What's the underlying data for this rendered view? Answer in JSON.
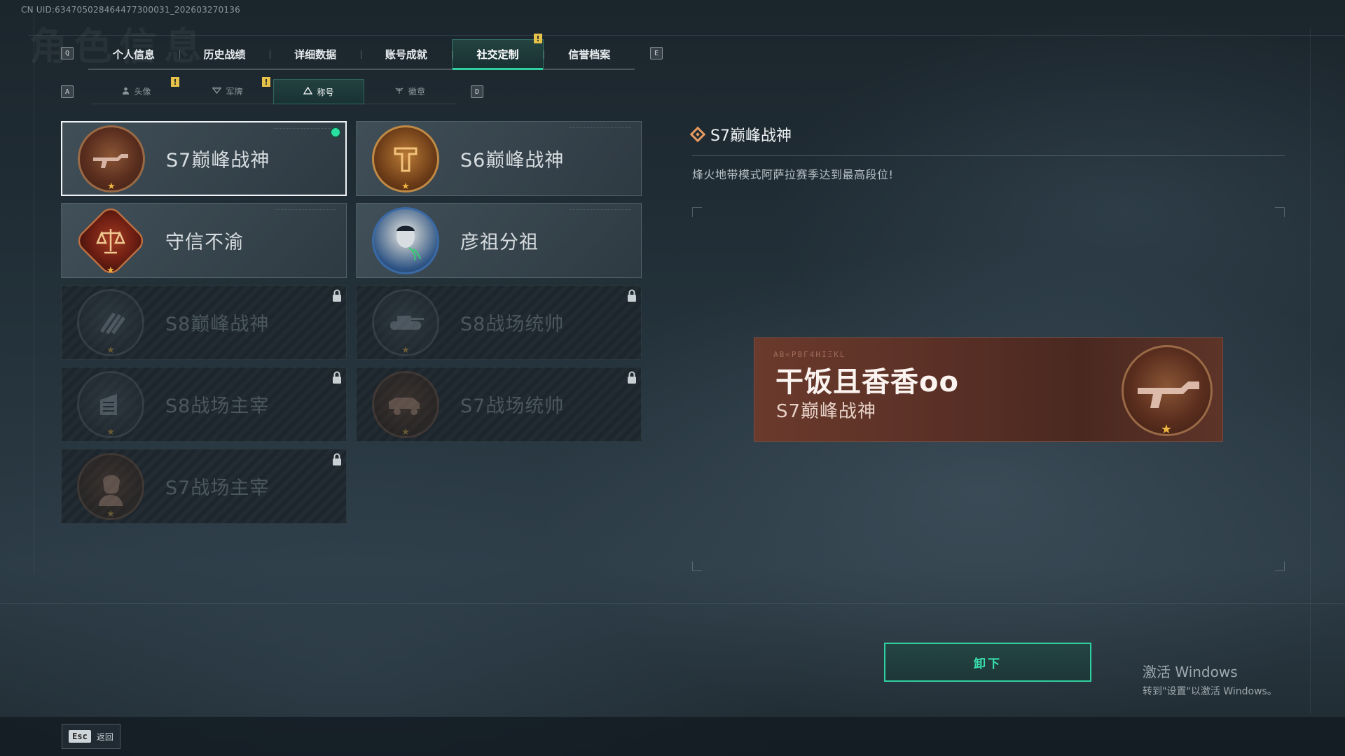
{
  "header": {
    "uid": "CN UID:634705028464477300031_202603270136",
    "bg_title": "角色信息"
  },
  "main_tabs": {
    "prev_key": "Q",
    "next_key": "E",
    "items": [
      {
        "label": "个人信息"
      },
      {
        "label": "历史战绩"
      },
      {
        "label": "详细数据"
      },
      {
        "label": "账号成就"
      },
      {
        "label": "社交定制",
        "active": true,
        "badge": "!"
      },
      {
        "label": "信誉档案"
      }
    ]
  },
  "sub_tabs": {
    "prev_key": "A",
    "next_key": "D",
    "items": [
      {
        "label": "头像",
        "icon": "person-icon",
        "badge": "!"
      },
      {
        "label": "军牌",
        "icon": "dogtag-icon",
        "badge": "!"
      },
      {
        "label": "称号",
        "icon": "triangle-icon",
        "active": true
      },
      {
        "label": "徽章",
        "icon": "wings-icon"
      }
    ]
  },
  "titles": [
    {
      "name": "S7巅峰战神",
      "emblem": "rifle-emblem-icon",
      "state": "equipped"
    },
    {
      "name": "S6巅峰战神",
      "emblem": "tower-emblem-icon",
      "state": "unlocked"
    },
    {
      "name": "守信不渝",
      "emblem": "scales-emblem-icon",
      "state": "unlocked"
    },
    {
      "name": "彦祖分祖",
      "emblem": "portrait-emblem-icon",
      "state": "unlocked"
    },
    {
      "name": "S8巅峰战神",
      "emblem": "stripes-emblem-icon",
      "state": "locked"
    },
    {
      "name": "S8战场统帅",
      "emblem": "tank-emblem-icon",
      "state": "locked"
    },
    {
      "name": "S8战场主宰",
      "emblem": "building-emblem-icon",
      "state": "locked"
    },
    {
      "name": "S7战场统帅",
      "emblem": "vehicle-emblem-icon",
      "state": "locked"
    },
    {
      "name": "S7战场主宰",
      "emblem": "soldier-emblem-icon",
      "state": "locked"
    }
  ],
  "detail": {
    "title": "S7巅峰战神",
    "description": "烽火地带模式阿萨拉赛季达到最高段位!"
  },
  "preview": {
    "cipher": "ΑΒ<ΡΒΓ4ΗΙΞΚL",
    "player_name": "干饭且香香oo",
    "title": "S7巅峰战神"
  },
  "actions": {
    "unequip_label": "卸下",
    "back_key": "Esc",
    "back_label": "返回"
  },
  "watermark": {
    "line1": "激活 Windows",
    "line2": "转到\"设置\"以激活 Windows。"
  },
  "colors": {
    "accent": "#2fd0a0",
    "badge": "#e6c24a",
    "preview_bg": "#5a3026"
  }
}
